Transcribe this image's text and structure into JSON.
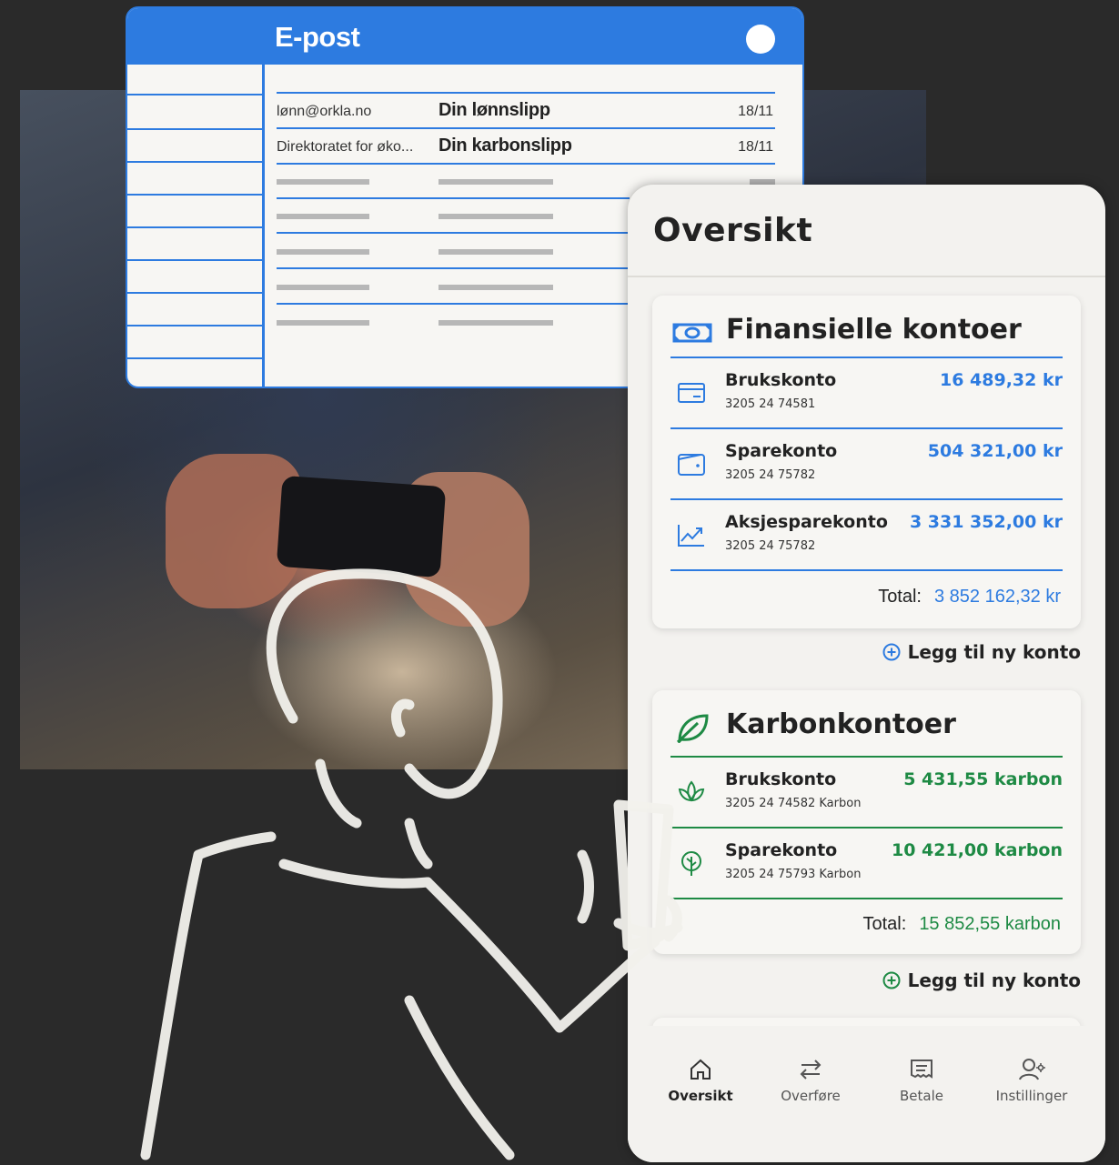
{
  "email": {
    "title": "E-post",
    "rows": [
      {
        "from": "lønn@orkla.no",
        "subject": "Din lønnslipp",
        "date": "18/11"
      },
      {
        "from": "Direktoratet for øko...",
        "subject": "Din karbonslipp",
        "date": "18/11"
      }
    ]
  },
  "app": {
    "title": "Oversikt",
    "finance": {
      "title": "Finansielle kontoer",
      "accounts": [
        {
          "name": "Brukskonto",
          "number": "3205 24 74581",
          "value": "16 489,32 kr",
          "icon": "card-icon"
        },
        {
          "name": "Sparekonto",
          "number": "3205 24 75782",
          "value": "504 321,00 kr",
          "icon": "wallet-icon"
        },
        {
          "name": "Aksjesparekonto",
          "number": "3205 24 75782",
          "value": "3 331 352,00 kr",
          "icon": "trend-up-icon"
        }
      ],
      "total_label": "Total:",
      "total_value": "3 852 162,32 kr",
      "add_label": "Legg til ny konto"
    },
    "carbon": {
      "title": "Karbonkontoer",
      "accounts": [
        {
          "name": "Brukskonto",
          "number": "3205 24 74582 Karbon",
          "value": "5 431,55 karbon",
          "icon": "lotus-icon"
        },
        {
          "name": "Sparekonto",
          "number": "3205 24 75793 Karbon",
          "value": "10 421,00 karbon",
          "icon": "tree-icon"
        }
      ],
      "total_label": "Total:",
      "total_value": "15 852,55 karbon",
      "add_label": "Legg til ny konto"
    },
    "tabs": [
      {
        "label": "Oversikt",
        "icon": "home-icon",
        "active": true
      },
      {
        "label": "Overføre",
        "icon": "transfer-icon",
        "active": false
      },
      {
        "label": "Betale",
        "icon": "invoice-icon",
        "active": false
      },
      {
        "label": "Instillinger",
        "icon": "user-settings-icon",
        "active": false
      }
    ],
    "colors": {
      "finance_accent": "#2d7be0",
      "carbon_accent": "#1e8a44"
    }
  }
}
